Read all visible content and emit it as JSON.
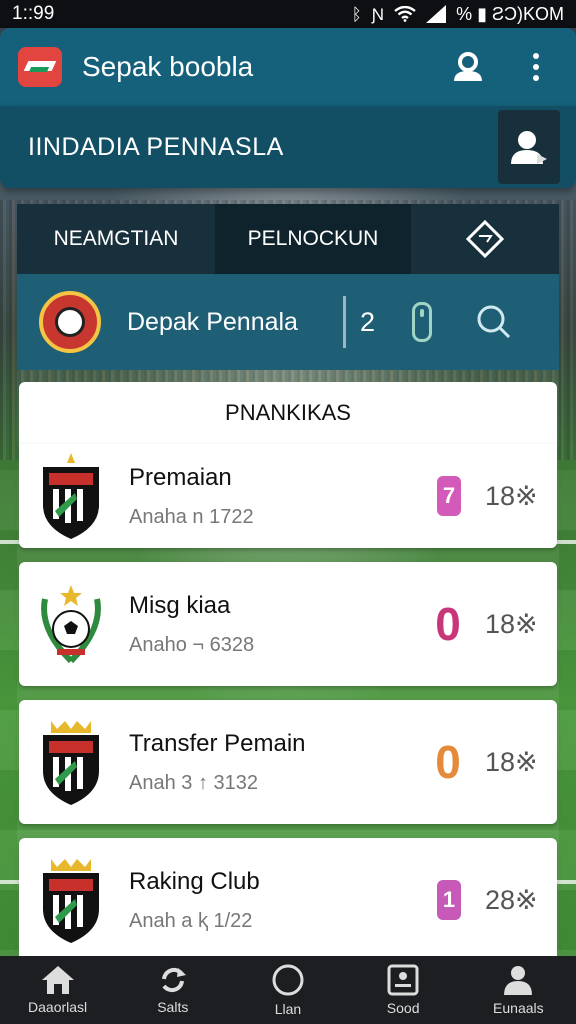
{
  "status_bar": {
    "time": "1::99",
    "right_text": "% ▮ ƧƆ)KOM",
    "icons": [
      "bluetooth-icon",
      "nfc-icon",
      "wifi-icon",
      "signal-icon",
      "battery-icon"
    ]
  },
  "app_bar": {
    "title": "Sepak boobla",
    "icons": [
      "app-logo",
      "account-icon",
      "more-vert-icon"
    ]
  },
  "sub_header": {
    "title": "IINDADIA PENNASLA",
    "icons": [
      "profile-icon"
    ]
  },
  "tabs": [
    {
      "label": "NEAMGTIAN"
    },
    {
      "label": "PELNOCKUN"
    },
    {
      "label": "",
      "icon": "diamond-badge-icon"
    }
  ],
  "club_bar": {
    "name": "Depak Pennala",
    "count": "2",
    "icons": [
      "club-crest-icon",
      "phone-icon",
      "search-icon"
    ]
  },
  "section": {
    "title": "PNANKIKAS"
  },
  "items": [
    {
      "title": "Premaian",
      "subtitle": "Anaha  n 1722",
      "badge": "7",
      "badge_color": "#d45ab9",
      "count": "18※"
    },
    {
      "title": "Misg kiaa",
      "subtitle": "Anaho  ¬ 6328",
      "badge": "0",
      "badge_color": "#c8357a",
      "count": "18※"
    },
    {
      "title": "Transfer Pemain",
      "subtitle": "Anah 3  ↑ 3132",
      "badge": "0",
      "badge_color": "#e58a3a",
      "count": "18※"
    },
    {
      "title": "Raking Club",
      "subtitle": "Anah a  ⱪ 1/22",
      "badge": "1",
      "badge_color": "#c75ab8",
      "count": "28※"
    }
  ],
  "bottom_nav": [
    {
      "label": "Daaorlasl",
      "icon": "home-icon"
    },
    {
      "label": "Salts",
      "icon": "refresh-icon"
    },
    {
      "label": "Llan",
      "icon": "circle-icon"
    },
    {
      "label": "Sood",
      "icon": "portrait-icon"
    },
    {
      "label": "Eunaals",
      "icon": "person-icon"
    }
  ]
}
